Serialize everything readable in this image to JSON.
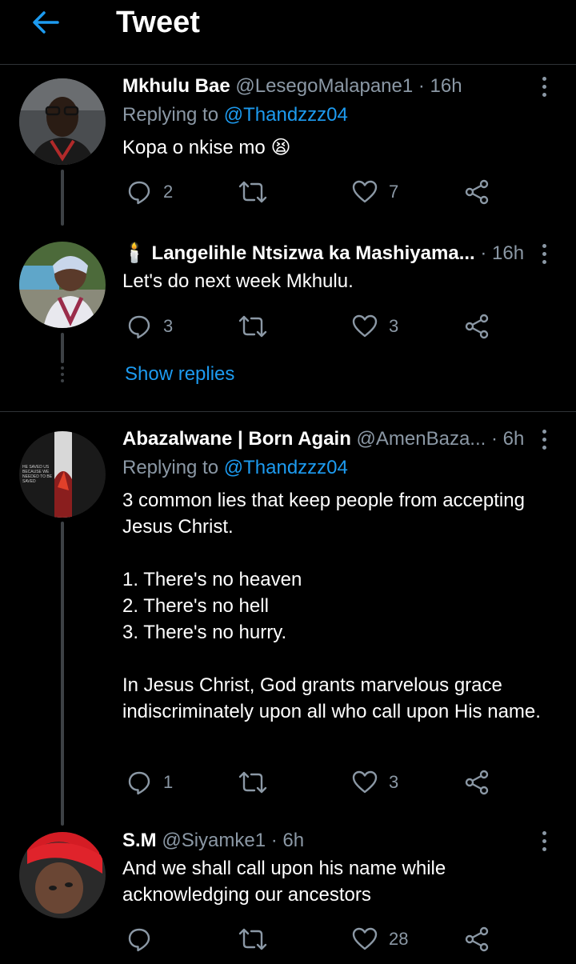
{
  "header": {
    "title": "Tweet",
    "back_icon": "arrow-left-icon"
  },
  "colors": {
    "accent": "#1d9bf0",
    "muted": "#8b98a5",
    "background": "#000000"
  },
  "tweets": [
    {
      "name": "Mkhulu Bae",
      "handle": "@LesegoMalapane1",
      "time": "· 16h",
      "reply_prefix": "Replying to ",
      "reply_handle": "@Thandzzz04",
      "text": "Kopa o nkise mo 😫",
      "replies": "2",
      "retweets": "",
      "likes": "7"
    },
    {
      "name": "🕯️ Langelihle Ntsizwa ka Mashiyama...",
      "handle": "",
      "time": "· 16h",
      "text": "Let's do next week Mkhulu.",
      "replies": "3",
      "retweets": "",
      "likes": "3"
    },
    {
      "name": "Abazalwane | Born Again",
      "handle": "@AmenBaza...",
      "time": "· 6h",
      "reply_prefix": "Replying to ",
      "reply_handle": "@Thandzzz04",
      "text": "3 common lies that keep people from accepting Jesus Christ.\n\n1. There's no heaven\n2. There's no hell\n3. There's no hurry.\n\nIn Jesus Christ, God grants marvelous grace indiscriminately upon all who call upon His name.",
      "replies": "1",
      "retweets": "",
      "likes": "3"
    },
    {
      "name": "S.M",
      "handle": "@Siyamke1",
      "time": "· 6h",
      "text": "And we shall call upon his name while acknowledging our ancestors",
      "replies": "",
      "retweets": "",
      "likes": "28"
    }
  ],
  "show_replies": "Show replies",
  "avatar3_caption": "HE SAVED US BECAUSE WE NEEDED TO BE SAVED"
}
